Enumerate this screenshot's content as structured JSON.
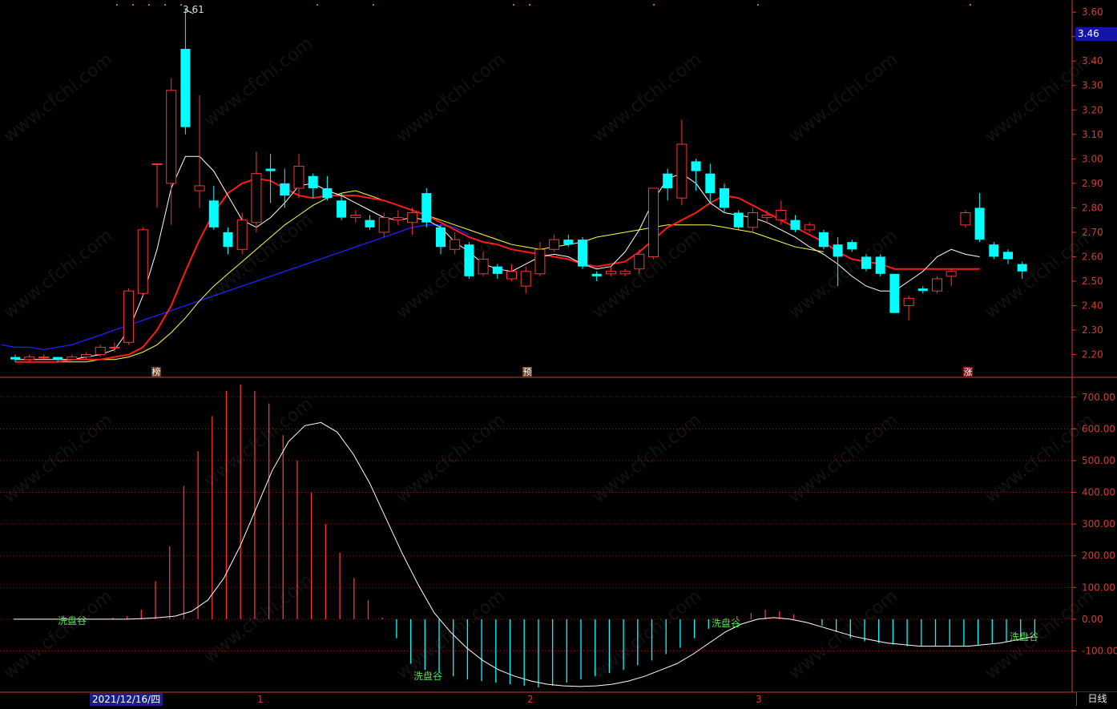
{
  "header": {
    "current_price": "3.46",
    "peak_label": "3.61"
  },
  "watermark": "www.cfchi.com",
  "markers": {
    "bang": "榜",
    "yu": "预",
    "zhang": "涨"
  },
  "footer": {
    "date": "2021/12/16/四",
    "months": [
      "1",
      "2",
      "3"
    ],
    "period": "日线"
  },
  "signals": [
    {
      "id": "s1",
      "text": "洗盘谷"
    },
    {
      "id": "s2",
      "text": "洗盘谷"
    },
    {
      "id": "s3",
      "text": "洗盘谷"
    },
    {
      "id": "s4",
      "text": "洗盘谷"
    }
  ],
  "colors": {
    "up": "#ff3232",
    "down": "#00ffff",
    "ma5": "#ffffff",
    "ma10": "#ff1a1a",
    "ma20": "#ffff40",
    "ma60": "#2020ff",
    "axis": "#d23c32",
    "grid": "#7a1a1a"
  },
  "chart_data": [
    {
      "type": "candlestick",
      "ylim": [
        2.12,
        3.63
      ],
      "yticks": [
        2.2,
        2.3,
        2.4,
        2.5,
        2.6,
        2.7,
        2.8,
        2.9,
        3.0,
        3.1,
        3.2,
        3.3,
        3.4,
        3.5,
        3.6
      ],
      "ytick_labels": [
        "2.20",
        "2.30",
        "2.40",
        "2.50",
        "2.60",
        "2.70",
        "2.80",
        "2.90",
        "3.00",
        "3.10",
        "3.20",
        "3.30",
        "3.40",
        "3.50",
        "3.60"
      ],
      "candles": [
        [
          2.19,
          2.18,
          2.2,
          2.17
        ],
        [
          2.18,
          2.19,
          2.2,
          2.17
        ],
        [
          2.19,
          2.19,
          2.2,
          2.18
        ],
        [
          2.19,
          2.18,
          2.19,
          2.17
        ],
        [
          2.18,
          2.19,
          2.2,
          2.18
        ],
        [
          2.19,
          2.2,
          2.21,
          2.18
        ],
        [
          2.2,
          2.23,
          2.24,
          2.19
        ],
        [
          2.23,
          2.23,
          2.25,
          2.21
        ],
        [
          2.25,
          2.46,
          2.47,
          2.24
        ],
        [
          2.45,
          2.71,
          2.72,
          2.44
        ],
        [
          2.98,
          2.98,
          2.98,
          2.8
        ],
        [
          2.9,
          3.28,
          3.33,
          2.73
        ],
        [
          3.45,
          3.13,
          3.61,
          3.1
        ],
        [
          2.87,
          2.89,
          3.26,
          2.8
        ],
        [
          2.83,
          2.72,
          2.89,
          2.71
        ],
        [
          2.7,
          2.64,
          2.72,
          2.61
        ],
        [
          2.63,
          2.75,
          2.78,
          2.61
        ],
        [
          2.74,
          2.94,
          3.03,
          2.7
        ],
        [
          2.96,
          2.95,
          3.02,
          2.82
        ],
        [
          2.9,
          2.85,
          2.96,
          2.8
        ],
        [
          2.88,
          2.97,
          3.02,
          2.84
        ],
        [
          2.93,
          2.88,
          2.94,
          2.84
        ],
        [
          2.88,
          2.84,
          2.93,
          2.83
        ],
        [
          2.83,
          2.76,
          2.86,
          2.75
        ],
        [
          2.76,
          2.77,
          2.79,
          2.74
        ],
        [
          2.75,
          2.72,
          2.77,
          2.71
        ],
        [
          2.7,
          2.76,
          2.78,
          2.68
        ],
        [
          2.75,
          2.76,
          2.79,
          2.73
        ],
        [
          2.74,
          2.78,
          2.8,
          2.69
        ],
        [
          2.86,
          2.74,
          2.88,
          2.72
        ],
        [
          2.72,
          2.64,
          2.73,
          2.61
        ],
        [
          2.63,
          2.67,
          2.7,
          2.61
        ],
        [
          2.65,
          2.52,
          2.66,
          2.51
        ],
        [
          2.53,
          2.59,
          2.62,
          2.52
        ],
        [
          2.56,
          2.53,
          2.57,
          2.51
        ],
        [
          2.51,
          2.54,
          2.57,
          2.5
        ],
        [
          2.48,
          2.54,
          2.56,
          2.45
        ],
        [
          2.53,
          2.63,
          2.66,
          2.52
        ],
        [
          2.63,
          2.67,
          2.69,
          2.62
        ],
        [
          2.67,
          2.65,
          2.69,
          2.64
        ],
        [
          2.67,
          2.56,
          2.68,
          2.55
        ],
        [
          2.53,
          2.52,
          2.54,
          2.5
        ],
        [
          2.53,
          2.54,
          2.56,
          2.52
        ],
        [
          2.53,
          2.54,
          2.55,
          2.52
        ],
        [
          2.55,
          2.61,
          2.63,
          2.53
        ],
        [
          2.6,
          2.88,
          2.88,
          2.59
        ],
        [
          2.94,
          2.88,
          2.96,
          2.83
        ],
        [
          2.84,
          3.06,
          3.16,
          2.81
        ],
        [
          2.99,
          2.95,
          3.0,
          2.87
        ],
        [
          2.94,
          2.86,
          2.98,
          2.82
        ],
        [
          2.88,
          2.8,
          2.9,
          2.78
        ],
        [
          2.78,
          2.72,
          2.79,
          2.71
        ],
        [
          2.72,
          2.78,
          2.8,
          2.7
        ],
        [
          2.76,
          2.77,
          2.79,
          2.74
        ],
        [
          2.75,
          2.79,
          2.83,
          2.73
        ],
        [
          2.75,
          2.71,
          2.77,
          2.7
        ],
        [
          2.71,
          2.73,
          2.74,
          2.7
        ],
        [
          2.7,
          2.64,
          2.71,
          2.63
        ],
        [
          2.65,
          2.6,
          2.68,
          2.48
        ],
        [
          2.66,
          2.63,
          2.67,
          2.62
        ],
        [
          2.6,
          2.55,
          2.61,
          2.54
        ],
        [
          2.6,
          2.53,
          2.61,
          2.52
        ],
        [
          2.53,
          2.37,
          2.53,
          2.37
        ],
        [
          2.4,
          2.43,
          2.44,
          2.34
        ],
        [
          2.47,
          2.46,
          2.48,
          2.45
        ],
        [
          2.46,
          2.51,
          2.52,
          2.45
        ],
        [
          2.52,
          2.54,
          2.55,
          2.48
        ],
        [
          2.73,
          2.78,
          2.79,
          2.72
        ],
        [
          2.8,
          2.67,
          2.86,
          2.66
        ],
        [
          2.65,
          2.6,
          2.66,
          2.59
        ],
        [
          2.62,
          2.59,
          2.63,
          2.57
        ],
        [
          2.57,
          2.54,
          2.58,
          2.51
        ]
      ],
      "ma5": [
        2.18,
        2.18,
        2.18,
        2.18,
        2.18,
        2.19,
        2.2,
        2.22,
        2.3,
        2.44,
        2.63,
        2.88,
        3.01,
        3.01,
        2.95,
        2.85,
        2.75,
        2.72,
        2.76,
        2.82,
        2.89,
        2.9,
        2.87,
        2.85,
        2.82,
        2.79,
        2.76,
        2.75,
        2.76,
        2.75,
        2.72,
        2.66,
        2.62,
        2.57,
        2.55,
        2.54,
        2.57,
        2.6,
        2.61,
        2.6,
        2.57,
        2.55,
        2.56,
        2.62,
        2.71,
        2.83,
        2.92,
        2.94,
        2.9,
        2.82,
        2.78,
        2.77,
        2.76,
        2.74,
        2.71,
        2.68,
        2.64,
        2.61,
        2.57,
        2.52,
        2.48,
        2.46,
        2.46,
        2.5,
        2.54,
        2.6,
        2.63,
        2.61,
        2.6
      ],
      "ma10": [
        2.17,
        2.17,
        2.17,
        2.17,
        2.18,
        2.18,
        2.18,
        2.19,
        2.2,
        2.23,
        2.3,
        2.4,
        2.54,
        2.67,
        2.78,
        2.86,
        2.9,
        2.92,
        2.91,
        2.88,
        2.85,
        2.84,
        2.85,
        2.85,
        2.85,
        2.84,
        2.83,
        2.81,
        2.79,
        2.77,
        2.74,
        2.71,
        2.68,
        2.66,
        2.65,
        2.63,
        2.62,
        2.61,
        2.6,
        2.59,
        2.57,
        2.56,
        2.57,
        2.58,
        2.62,
        2.67,
        2.72,
        2.75,
        2.78,
        2.82,
        2.85,
        2.84,
        2.81,
        2.78,
        2.75,
        2.72,
        2.69,
        2.66,
        2.62,
        2.59,
        2.58,
        2.57,
        2.55,
        2.55,
        2.55,
        2.55,
        2.55,
        2.55,
        2.55
      ],
      "ma20": [
        2.17,
        2.17,
        2.17,
        2.17,
        2.17,
        2.17,
        2.18,
        2.18,
        2.19,
        2.21,
        2.24,
        2.29,
        2.35,
        2.42,
        2.48,
        2.53,
        2.58,
        2.63,
        2.68,
        2.73,
        2.77,
        2.81,
        2.84,
        2.86,
        2.87,
        2.85,
        2.83,
        2.81,
        2.79,
        2.77,
        2.75,
        2.73,
        2.71,
        2.69,
        2.67,
        2.65,
        2.64,
        2.63,
        2.64,
        2.65,
        2.66,
        2.68,
        2.69,
        2.7,
        2.71,
        2.72,
        2.73,
        2.73,
        2.73,
        2.73,
        2.72,
        2.71,
        2.7,
        2.68,
        2.66,
        2.64,
        2.63,
        2.62
      ],
      "ma60": [
        2.24,
        2.23,
        2.23,
        2.22,
        2.23,
        2.24,
        2.26,
        2.28,
        2.3,
        2.32,
        2.34,
        2.36,
        2.38,
        2.4,
        2.42,
        2.44,
        2.46,
        2.48,
        2.5,
        2.52,
        2.54,
        2.56,
        2.58,
        2.6,
        2.62,
        2.64,
        2.66,
        2.68,
        2.7,
        2.72,
        2.73,
        2.73,
        2.72,
        2.69
      ]
    },
    {
      "type": "bar",
      "ylim": [
        -230,
        760
      ],
      "yticks": [
        -100,
        0,
        100,
        200,
        300,
        400,
        500,
        600,
        700
      ],
      "ytick_labels": [
        "-100.00",
        "0.00",
        "100.00",
        "200.00",
        "300.00",
        "400.00",
        "500.00",
        "600.00",
        "700.00"
      ],
      "values": [
        0,
        0,
        0,
        0,
        0,
        0,
        2,
        5,
        10,
        30,
        120,
        230,
        420,
        530,
        640,
        720,
        740,
        720,
        680,
        580,
        500,
        400,
        300,
        210,
        130,
        60,
        5,
        -60,
        -140,
        -160,
        -170,
        -180,
        -190,
        -195,
        -200,
        -205,
        -210,
        -215,
        -210,
        -200,
        -190,
        -180,
        -170,
        -160,
        -145,
        -130,
        -110,
        -90,
        -60,
        -30,
        0,
        10,
        20,
        30,
        25,
        15,
        0,
        -20,
        -40,
        -60,
        -70,
        -75,
        -80,
        -85,
        -85,
        -85,
        -85,
        -85,
        -80,
        -75,
        -70,
        -60,
        -55
      ],
      "line": [
        0,
        0,
        0,
        0,
        0,
        0,
        0,
        0,
        2,
        5,
        10,
        25,
        60,
        130,
        230,
        350,
        470,
        560,
        610,
        620,
        590,
        520,
        430,
        320,
        210,
        110,
        20,
        -40,
        -90,
        -130,
        -160,
        -180,
        -195,
        -205,
        -210,
        -212,
        -210,
        -205,
        -195,
        -180,
        -160,
        -140,
        -110,
        -75,
        -40,
        -15,
        0,
        5,
        0,
        -10,
        -25,
        -40,
        -55,
        -65,
        -75,
        -80,
        -85,
        -85,
        -85,
        -85,
        -80,
        -75,
        -65,
        -55
      ]
    }
  ]
}
